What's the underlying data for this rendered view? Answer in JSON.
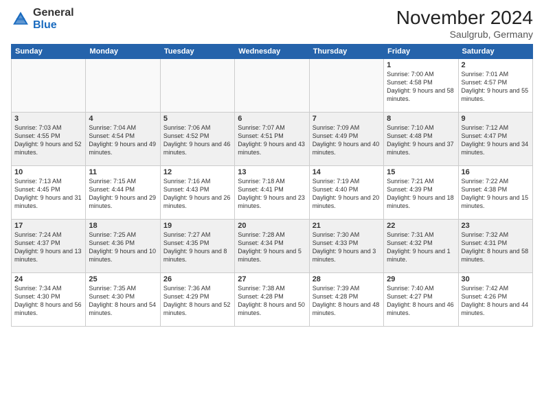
{
  "header": {
    "logo_general": "General",
    "logo_blue": "Blue",
    "month_title": "November 2024",
    "location": "Saulgrub, Germany"
  },
  "weekdays": [
    "Sunday",
    "Monday",
    "Tuesday",
    "Wednesday",
    "Thursday",
    "Friday",
    "Saturday"
  ],
  "weeks": [
    [
      {
        "day": "",
        "detail": ""
      },
      {
        "day": "",
        "detail": ""
      },
      {
        "day": "",
        "detail": ""
      },
      {
        "day": "",
        "detail": ""
      },
      {
        "day": "",
        "detail": ""
      },
      {
        "day": "1",
        "detail": "Sunrise: 7:00 AM\nSunset: 4:58 PM\nDaylight: 9 hours\nand 58 minutes."
      },
      {
        "day": "2",
        "detail": "Sunrise: 7:01 AM\nSunset: 4:57 PM\nDaylight: 9 hours\nand 55 minutes."
      }
    ],
    [
      {
        "day": "3",
        "detail": "Sunrise: 7:03 AM\nSunset: 4:55 PM\nDaylight: 9 hours\nand 52 minutes."
      },
      {
        "day": "4",
        "detail": "Sunrise: 7:04 AM\nSunset: 4:54 PM\nDaylight: 9 hours\nand 49 minutes."
      },
      {
        "day": "5",
        "detail": "Sunrise: 7:06 AM\nSunset: 4:52 PM\nDaylight: 9 hours\nand 46 minutes."
      },
      {
        "day": "6",
        "detail": "Sunrise: 7:07 AM\nSunset: 4:51 PM\nDaylight: 9 hours\nand 43 minutes."
      },
      {
        "day": "7",
        "detail": "Sunrise: 7:09 AM\nSunset: 4:49 PM\nDaylight: 9 hours\nand 40 minutes."
      },
      {
        "day": "8",
        "detail": "Sunrise: 7:10 AM\nSunset: 4:48 PM\nDaylight: 9 hours\nand 37 minutes."
      },
      {
        "day": "9",
        "detail": "Sunrise: 7:12 AM\nSunset: 4:47 PM\nDaylight: 9 hours\nand 34 minutes."
      }
    ],
    [
      {
        "day": "10",
        "detail": "Sunrise: 7:13 AM\nSunset: 4:45 PM\nDaylight: 9 hours\nand 31 minutes."
      },
      {
        "day": "11",
        "detail": "Sunrise: 7:15 AM\nSunset: 4:44 PM\nDaylight: 9 hours\nand 29 minutes."
      },
      {
        "day": "12",
        "detail": "Sunrise: 7:16 AM\nSunset: 4:43 PM\nDaylight: 9 hours\nand 26 minutes."
      },
      {
        "day": "13",
        "detail": "Sunrise: 7:18 AM\nSunset: 4:41 PM\nDaylight: 9 hours\nand 23 minutes."
      },
      {
        "day": "14",
        "detail": "Sunrise: 7:19 AM\nSunset: 4:40 PM\nDaylight: 9 hours\nand 20 minutes."
      },
      {
        "day": "15",
        "detail": "Sunrise: 7:21 AM\nSunset: 4:39 PM\nDaylight: 9 hours\nand 18 minutes."
      },
      {
        "day": "16",
        "detail": "Sunrise: 7:22 AM\nSunset: 4:38 PM\nDaylight: 9 hours\nand 15 minutes."
      }
    ],
    [
      {
        "day": "17",
        "detail": "Sunrise: 7:24 AM\nSunset: 4:37 PM\nDaylight: 9 hours\nand 13 minutes."
      },
      {
        "day": "18",
        "detail": "Sunrise: 7:25 AM\nSunset: 4:36 PM\nDaylight: 9 hours\nand 10 minutes."
      },
      {
        "day": "19",
        "detail": "Sunrise: 7:27 AM\nSunset: 4:35 PM\nDaylight: 9 hours\nand 8 minutes."
      },
      {
        "day": "20",
        "detail": "Sunrise: 7:28 AM\nSunset: 4:34 PM\nDaylight: 9 hours\nand 5 minutes."
      },
      {
        "day": "21",
        "detail": "Sunrise: 7:30 AM\nSunset: 4:33 PM\nDaylight: 9 hours\nand 3 minutes."
      },
      {
        "day": "22",
        "detail": "Sunrise: 7:31 AM\nSunset: 4:32 PM\nDaylight: 9 hours\nand 1 minute."
      },
      {
        "day": "23",
        "detail": "Sunrise: 7:32 AM\nSunset: 4:31 PM\nDaylight: 8 hours\nand 58 minutes."
      }
    ],
    [
      {
        "day": "24",
        "detail": "Sunrise: 7:34 AM\nSunset: 4:30 PM\nDaylight: 8 hours\nand 56 minutes."
      },
      {
        "day": "25",
        "detail": "Sunrise: 7:35 AM\nSunset: 4:30 PM\nDaylight: 8 hours\nand 54 minutes."
      },
      {
        "day": "26",
        "detail": "Sunrise: 7:36 AM\nSunset: 4:29 PM\nDaylight: 8 hours\nand 52 minutes."
      },
      {
        "day": "27",
        "detail": "Sunrise: 7:38 AM\nSunset: 4:28 PM\nDaylight: 8 hours\nand 50 minutes."
      },
      {
        "day": "28",
        "detail": "Sunrise: 7:39 AM\nSunset: 4:28 PM\nDaylight: 8 hours\nand 48 minutes."
      },
      {
        "day": "29",
        "detail": "Sunrise: 7:40 AM\nSunset: 4:27 PM\nDaylight: 8 hours\nand 46 minutes."
      },
      {
        "day": "30",
        "detail": "Sunrise: 7:42 AM\nSunset: 4:26 PM\nDaylight: 8 hours\nand 44 minutes."
      }
    ]
  ]
}
